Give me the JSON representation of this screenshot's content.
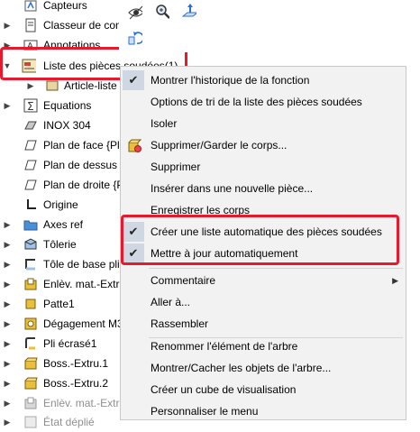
{
  "tree": {
    "items": [
      {
        "label": "Capteurs",
        "icon": "sensor-icon",
        "arrow": ""
      },
      {
        "label": "Classeur de con",
        "icon": "binder-icon",
        "arrow": "▶"
      },
      {
        "label": "Annotations",
        "icon": "annotations-icon",
        "arrow": "▶"
      },
      {
        "label": "Liste des pièces soudées(1)",
        "icon": "cut-list-icon",
        "arrow": "▼"
      },
      {
        "label": "Article-liste",
        "icon": "cut-list-item-icon",
        "arrow": "▶"
      },
      {
        "label": "Equations",
        "icon": "equations-icon",
        "arrow": "▶"
      },
      {
        "label": "INOX 304",
        "icon": "material-icon",
        "arrow": ""
      },
      {
        "label": "Plan de face {Pla",
        "icon": "plane-icon",
        "arrow": ""
      },
      {
        "label": "Plan de dessus {",
        "icon": "plane-icon",
        "arrow": ""
      },
      {
        "label": "Plan de droite {Pl",
        "icon": "plane-icon",
        "arrow": ""
      },
      {
        "label": "Origine",
        "icon": "origin-icon",
        "arrow": ""
      },
      {
        "label": "Axes ref",
        "icon": "folder-icon",
        "arrow": "▶"
      },
      {
        "label": "Tôlerie",
        "icon": "sheet-metal-icon",
        "arrow": "▶"
      },
      {
        "label": "Tôle de base plie",
        "icon": "base-flange-icon",
        "arrow": "▶"
      },
      {
        "label": "Enlèv. mat.-Extru",
        "icon": "cut-extrude-icon",
        "arrow": "▶"
      },
      {
        "label": "Patte1",
        "icon": "tab-icon",
        "arrow": "▶"
      },
      {
        "label": "Dégagement M3",
        "icon": "hole-icon",
        "arrow": "▶"
      },
      {
        "label": "Pli écrasé1",
        "icon": "hem-icon",
        "arrow": "▶"
      },
      {
        "label": "Boss.-Extru.1",
        "icon": "boss-extrude-icon",
        "arrow": "▶"
      },
      {
        "label": "Boss.-Extru.2",
        "icon": "boss-extrude-icon",
        "arrow": "▶"
      },
      {
        "label": "Enlèv. mat.-Extr",
        "icon": "cut-extrude-icon",
        "arrow": "▶",
        "dim": true
      },
      {
        "label": "État déplié",
        "icon": "flat-pattern-icon",
        "arrow": "▶",
        "dim": true
      }
    ]
  },
  "toolbar": {
    "icons": [
      "hide-show-icon",
      "zoom-icon",
      "normal-to-icon",
      "rotate-icon"
    ]
  },
  "menu": {
    "items": [
      {
        "label": "Montrer l'historique de la fonction",
        "checked": true,
        "icon": ""
      },
      {
        "label": "Options de tri de la liste des pièces soudées",
        "checked": false,
        "icon": ""
      },
      {
        "label": "Isoler",
        "checked": false,
        "icon": ""
      },
      {
        "label": "Supprimer/Garder le corps...",
        "checked": false,
        "icon": "delete-keep-body-icon"
      },
      {
        "label": "Supprimer",
        "checked": false,
        "icon": ""
      },
      {
        "label": "Insérer dans une nouvelle pièce...",
        "checked": false,
        "icon": ""
      },
      {
        "label": "Enregistrer les corps",
        "checked": false,
        "icon": ""
      },
      {
        "label": "Créer une liste automatique des pièces soudées",
        "checked": true,
        "icon": ""
      },
      {
        "label": "Mettre à jour automatiquement",
        "checked": true,
        "icon": ""
      },
      {
        "label": "Commentaire",
        "checked": false,
        "icon": "",
        "submenu": true
      },
      {
        "label": "Aller à...",
        "checked": false,
        "icon": ""
      },
      {
        "label": "Rassembler",
        "checked": false,
        "icon": ""
      },
      {
        "label": "Renommer l'élément de l'arbre",
        "checked": false,
        "icon": ""
      },
      {
        "label": "Montrer/Cacher les objets de l'arbre...",
        "checked": false,
        "icon": ""
      },
      {
        "label": "Créer un cube de visualisation",
        "checked": false,
        "icon": ""
      },
      {
        "label": "Personnaliser le menu",
        "checked": false,
        "icon": ""
      }
    ],
    "check_glyph": "✔",
    "submenu_glyph": "▶"
  },
  "colors": {
    "highlight": "#e8192c",
    "menu_bg": "#f2f2f2",
    "check_bg": "#cfd7e2"
  }
}
